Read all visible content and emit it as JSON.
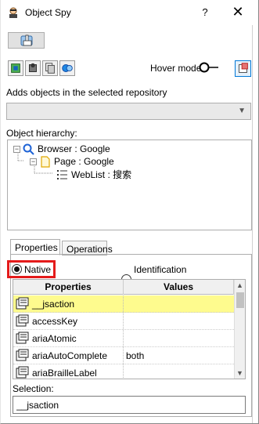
{
  "window": {
    "title": "Object Spy",
    "help_label": "?",
    "close_label": "✕"
  },
  "toolbar": {
    "spy_icon": "pointing-hand-icon",
    "hover_mode_label": "Hover mode",
    "tools": [
      "object-icon",
      "object-highlight-icon",
      "copy-icon",
      "record-icon"
    ]
  },
  "repository": {
    "label": "Adds objects in the selected repository",
    "selected": ""
  },
  "hierarchy": {
    "label": "Object hierarchy:",
    "nodes": [
      {
        "label": "Browser : Google"
      },
      {
        "label": "Page : Google"
      },
      {
        "label": "WebList : 搜索"
      }
    ]
  },
  "tabs": [
    {
      "label": "Properties"
    },
    {
      "label": "Operations"
    }
  ],
  "modes": {
    "native": "Native",
    "identification": "Identification"
  },
  "grid": {
    "headers": {
      "properties": "Properties",
      "values": "Values"
    },
    "rows": [
      {
        "name": "__jsaction",
        "value": ""
      },
      {
        "name": "accessKey",
        "value": ""
      },
      {
        "name": "ariaAtomic",
        "value": ""
      },
      {
        "name": "ariaAutoComplete",
        "value": "both"
      },
      {
        "name": "ariaBrailleLabel",
        "value": ""
      }
    ]
  },
  "selection": {
    "label": "Selection:",
    "value": "__jsaction"
  },
  "colors": {
    "highlight_row": "#fefb8e",
    "annotation_box": "#e41b1b",
    "accent": "#0078d7"
  }
}
